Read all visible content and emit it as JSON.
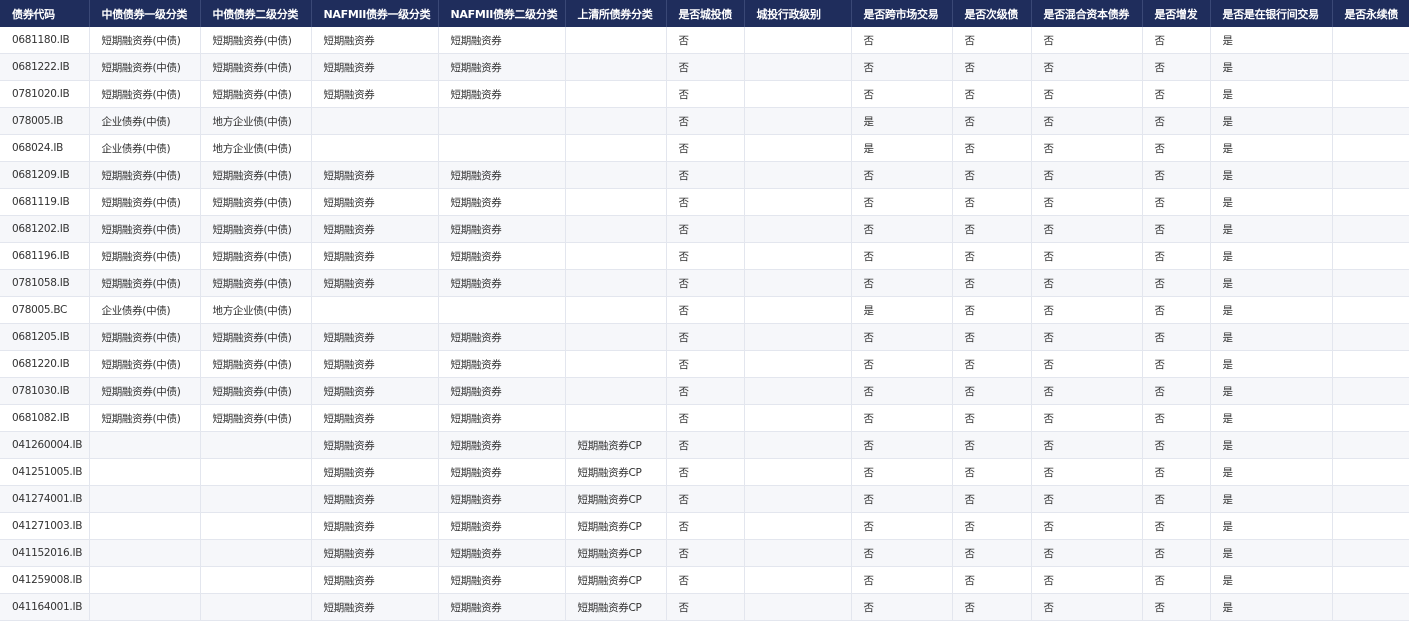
{
  "table": {
    "headers": [
      "债券代码",
      "中债债券一级分类",
      "中债债券二级分类",
      "NAFMII债券一级分类",
      "NAFMII债券二级分类",
      "上清所债券分类",
      "是否城投债",
      "城投行政级别",
      "是否跨市场交易",
      "是否次级债",
      "是否混合资本债券",
      "是否增发",
      "是否是在银行间交易",
      "是否永续债"
    ],
    "rows": [
      [
        "0681180.IB",
        "短期融资券(中债)",
        "短期融资券(中债)",
        "短期融资券",
        "短期融资券",
        "",
        "否",
        "",
        "否",
        "否",
        "否",
        "否",
        "是",
        ""
      ],
      [
        "0681222.IB",
        "短期融资券(中债)",
        "短期融资券(中债)",
        "短期融资券",
        "短期融资券",
        "",
        "否",
        "",
        "否",
        "否",
        "否",
        "否",
        "是",
        ""
      ],
      [
        "0781020.IB",
        "短期融资券(中债)",
        "短期融资券(中债)",
        "短期融资券",
        "短期融资券",
        "",
        "否",
        "",
        "否",
        "否",
        "否",
        "否",
        "是",
        ""
      ],
      [
        "078005.IB",
        "企业债券(中债)",
        "地方企业债(中债)",
        "",
        "",
        "",
        "否",
        "",
        "是",
        "否",
        "否",
        "否",
        "是",
        ""
      ],
      [
        "068024.IB",
        "企业债券(中债)",
        "地方企业债(中债)",
        "",
        "",
        "",
        "否",
        "",
        "是",
        "否",
        "否",
        "否",
        "是",
        ""
      ],
      [
        "0681209.IB",
        "短期融资券(中债)",
        "短期融资券(中债)",
        "短期融资券",
        "短期融资券",
        "",
        "否",
        "",
        "否",
        "否",
        "否",
        "否",
        "是",
        ""
      ],
      [
        "0681119.IB",
        "短期融资券(中债)",
        "短期融资券(中债)",
        "短期融资券",
        "短期融资券",
        "",
        "否",
        "",
        "否",
        "否",
        "否",
        "否",
        "是",
        ""
      ],
      [
        "0681202.IB",
        "短期融资券(中债)",
        "短期融资券(中债)",
        "短期融资券",
        "短期融资券",
        "",
        "否",
        "",
        "否",
        "否",
        "否",
        "否",
        "是",
        ""
      ],
      [
        "0681196.IB",
        "短期融资券(中债)",
        "短期融资券(中债)",
        "短期融资券",
        "短期融资券",
        "",
        "否",
        "",
        "否",
        "否",
        "否",
        "否",
        "是",
        ""
      ],
      [
        "0781058.IB",
        "短期融资券(中债)",
        "短期融资券(中债)",
        "短期融资券",
        "短期融资券",
        "",
        "否",
        "",
        "否",
        "否",
        "否",
        "否",
        "是",
        ""
      ],
      [
        "078005.BC",
        "企业债券(中债)",
        "地方企业债(中债)",
        "",
        "",
        "",
        "否",
        "",
        "是",
        "否",
        "否",
        "否",
        "是",
        ""
      ],
      [
        "0681205.IB",
        "短期融资券(中债)",
        "短期融资券(中债)",
        "短期融资券",
        "短期融资券",
        "",
        "否",
        "",
        "否",
        "否",
        "否",
        "否",
        "是",
        ""
      ],
      [
        "0681220.IB",
        "短期融资券(中债)",
        "短期融资券(中债)",
        "短期融资券",
        "短期融资券",
        "",
        "否",
        "",
        "否",
        "否",
        "否",
        "否",
        "是",
        ""
      ],
      [
        "0781030.IB",
        "短期融资券(中债)",
        "短期融资券(中债)",
        "短期融资券",
        "短期融资券",
        "",
        "否",
        "",
        "否",
        "否",
        "否",
        "否",
        "是",
        ""
      ],
      [
        "0681082.IB",
        "短期融资券(中债)",
        "短期融资券(中债)",
        "短期融资券",
        "短期融资券",
        "",
        "否",
        "",
        "否",
        "否",
        "否",
        "否",
        "是",
        ""
      ],
      [
        "041260004.IB",
        "",
        "",
        "短期融资券",
        "短期融资券",
        "短期融资券CP",
        "否",
        "",
        "否",
        "否",
        "否",
        "否",
        "是",
        ""
      ],
      [
        "041251005.IB",
        "",
        "",
        "短期融资券",
        "短期融资券",
        "短期融资券CP",
        "否",
        "",
        "否",
        "否",
        "否",
        "否",
        "是",
        ""
      ],
      [
        "041274001.IB",
        "",
        "",
        "短期融资券",
        "短期融资券",
        "短期融资券CP",
        "否",
        "",
        "否",
        "否",
        "否",
        "否",
        "是",
        ""
      ],
      [
        "041271003.IB",
        "",
        "",
        "短期融资券",
        "短期融资券",
        "短期融资券CP",
        "否",
        "",
        "否",
        "否",
        "否",
        "否",
        "是",
        ""
      ],
      [
        "041152016.IB",
        "",
        "",
        "短期融资券",
        "短期融资券",
        "短期融资券CP",
        "否",
        "",
        "否",
        "否",
        "否",
        "否",
        "是",
        ""
      ],
      [
        "041259008.IB",
        "",
        "",
        "短期融资券",
        "短期融资券",
        "短期融资券CP",
        "否",
        "",
        "否",
        "否",
        "否",
        "否",
        "是",
        ""
      ],
      [
        "041164001.IB",
        "",
        "",
        "短期融资券",
        "短期融资券",
        "短期融资券CP",
        "否",
        "",
        "否",
        "否",
        "否",
        "否",
        "是",
        ""
      ]
    ]
  }
}
